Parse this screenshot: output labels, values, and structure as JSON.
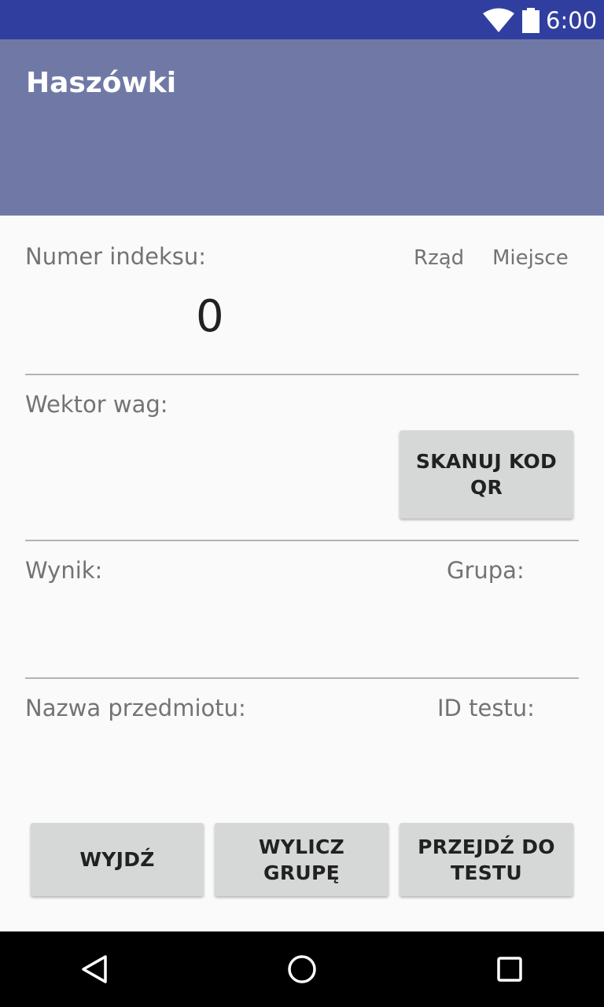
{
  "status_bar": {
    "time": "6:00",
    "wifi_icon": "wifi-icon",
    "battery_icon": "battery-icon"
  },
  "app_bar": {
    "title": "Haszówki"
  },
  "form": {
    "index_label": "Numer indeksu:",
    "row_label": "Rząd",
    "seat_label": "Miejsce",
    "index_value": "0",
    "weights_label": "Wektor wag:",
    "scan_button": "SKANUJ KOD QR",
    "result_label": "Wynik:",
    "group_label": "Grupa:",
    "subject_label": "Nazwa przedmiotu:",
    "test_id_label": "ID testu:"
  },
  "buttons": {
    "exit": "WYJDŹ",
    "compute_group": "WYLICZ GRUPĘ",
    "go_to_test": "PRZEJDŹ DO TESTU"
  },
  "nav_bar": {
    "back_icon": "back-icon",
    "home_icon": "home-icon",
    "recents_icon": "recents-icon"
  },
  "colors": {
    "status_bar": "#303f9f",
    "app_bar": "#7079a6",
    "background": "#fafafa",
    "button": "#d6d7d7",
    "label_text": "#737373"
  }
}
